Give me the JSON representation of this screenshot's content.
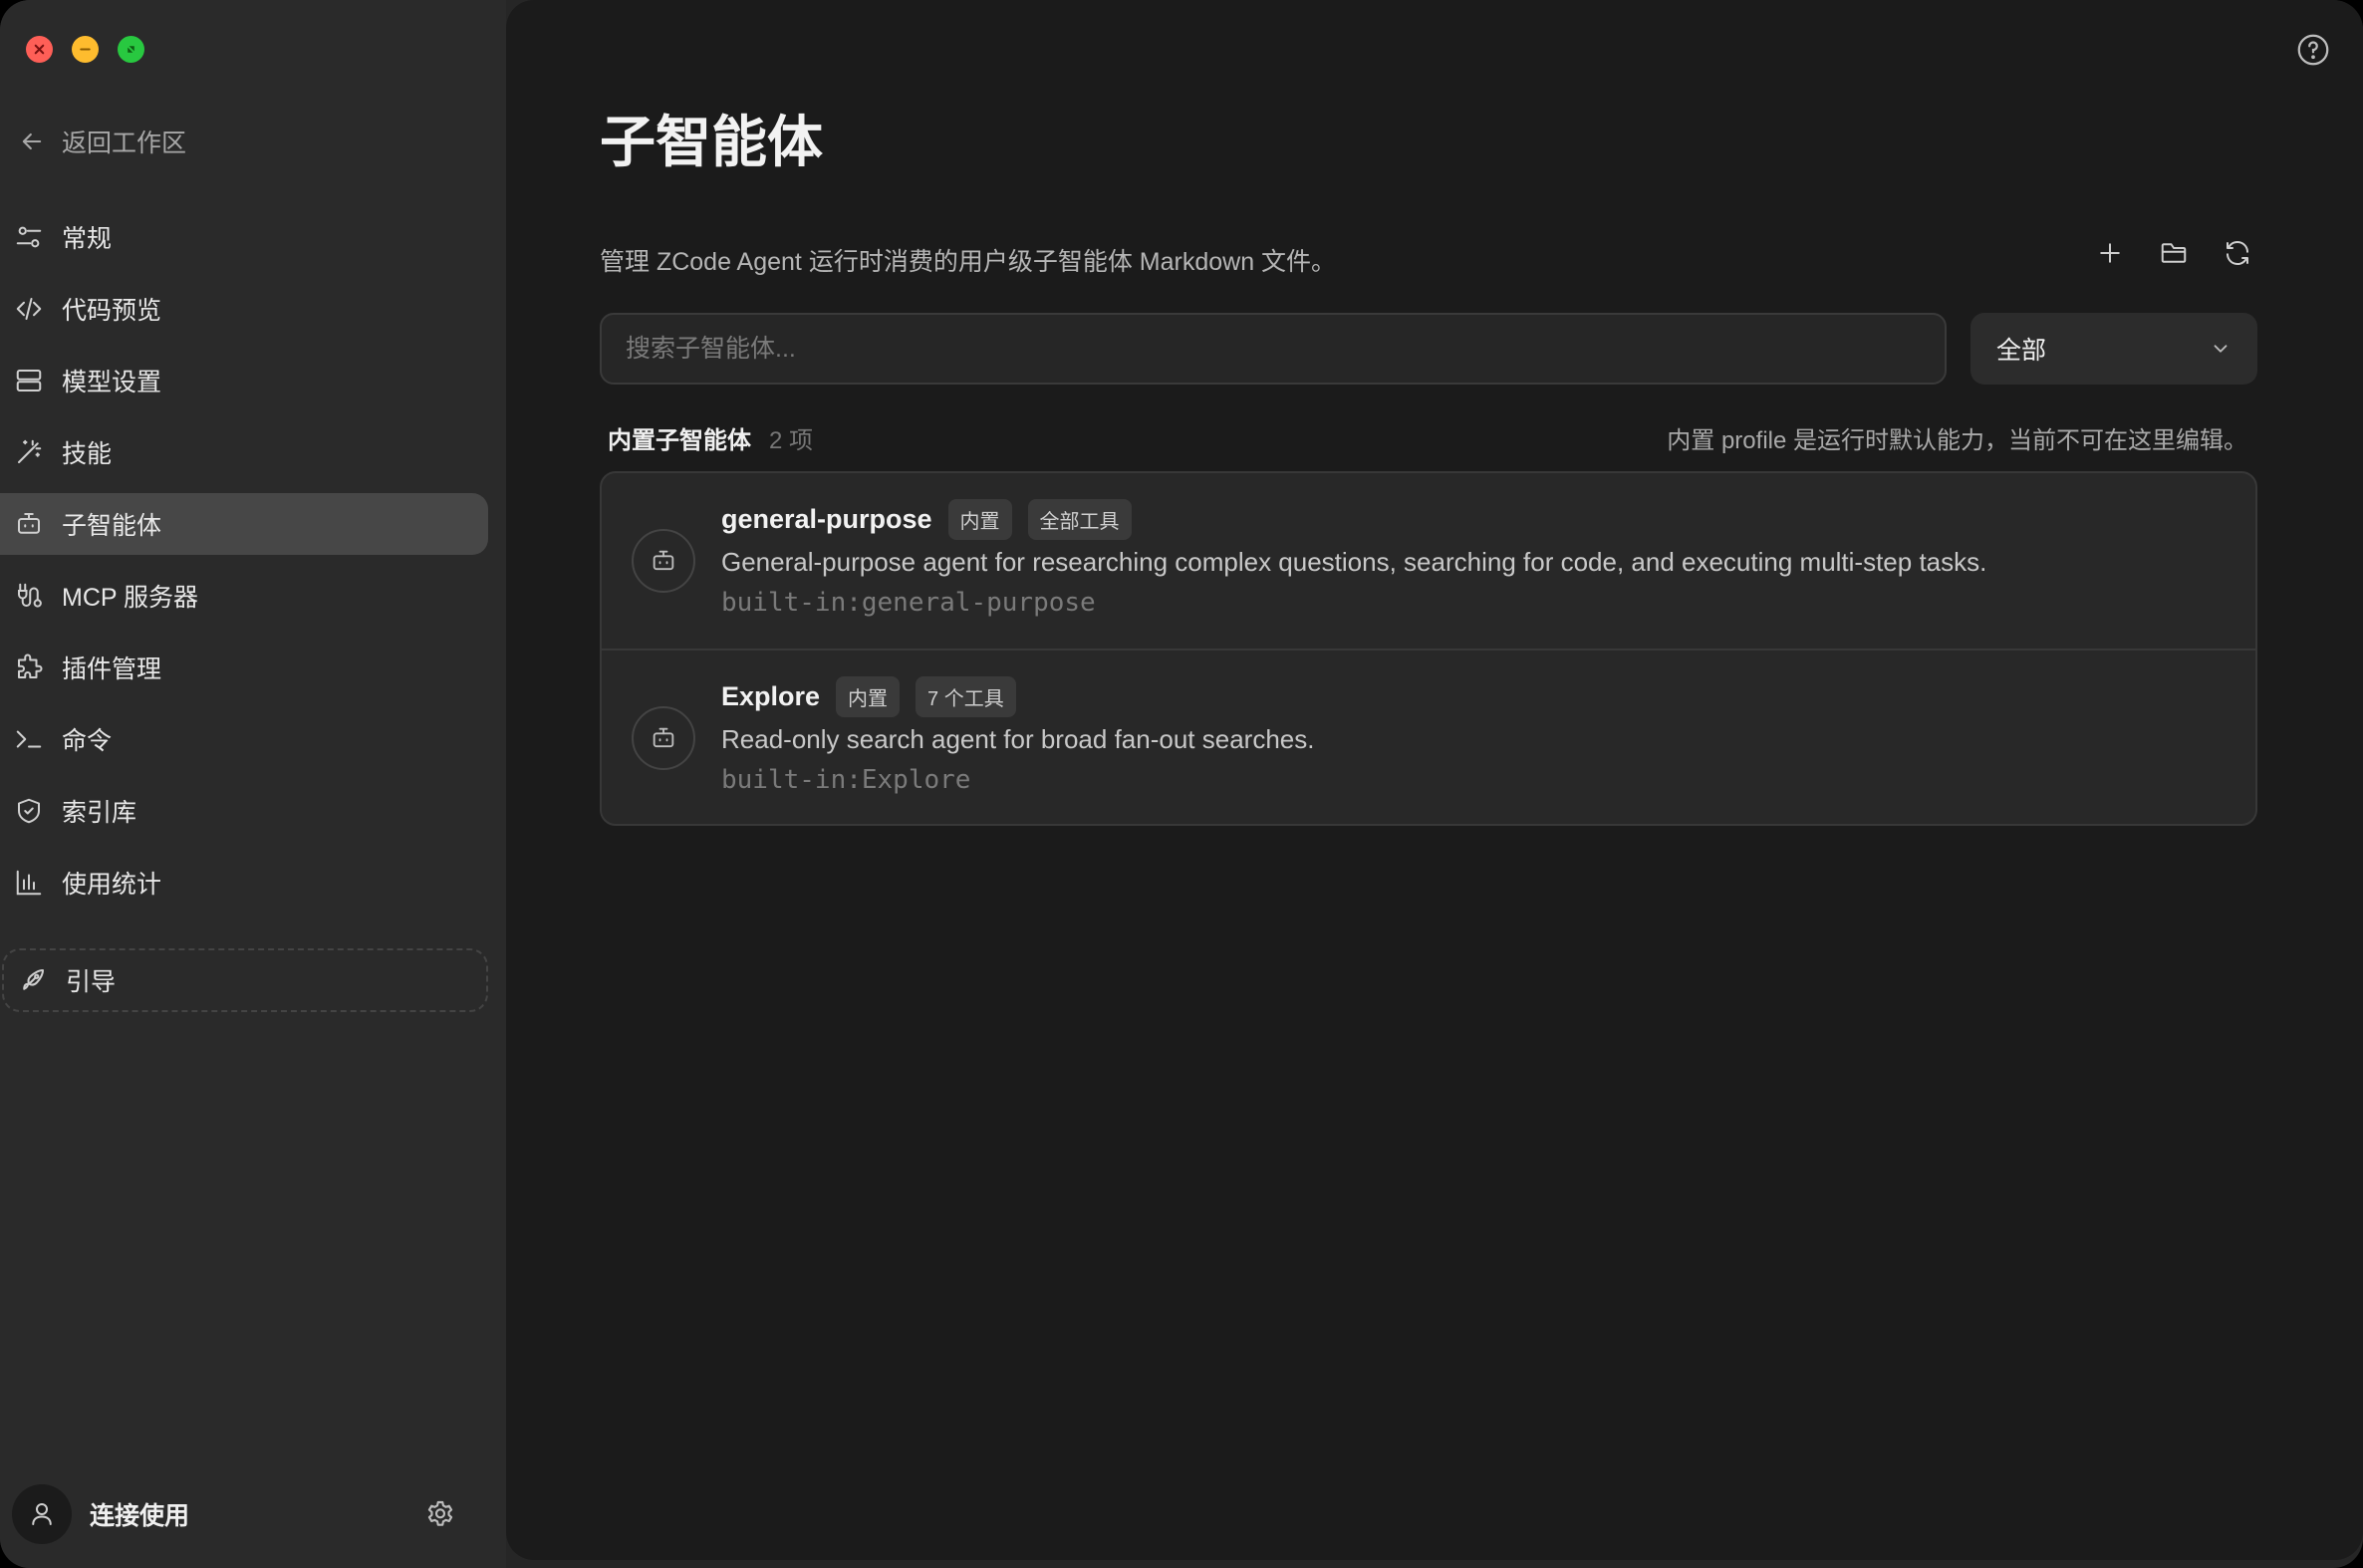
{
  "window": {
    "traffic_lights": [
      "close",
      "minimize",
      "maximize"
    ]
  },
  "sidebar": {
    "back_label": "返回工作区",
    "items": [
      {
        "label": "常规",
        "icon": "sliders-icon"
      },
      {
        "label": "代码预览",
        "icon": "code-icon"
      },
      {
        "label": "模型设置",
        "icon": "server-icon"
      },
      {
        "label": "技能",
        "icon": "magic-wand-icon"
      },
      {
        "label": "子智能体",
        "icon": "bot-icon",
        "active": true
      },
      {
        "label": "MCP 服务器",
        "icon": "plug-icon"
      },
      {
        "label": "插件管理",
        "icon": "puzzle-icon"
      },
      {
        "label": "命令",
        "icon": "terminal-icon"
      },
      {
        "label": "索引库",
        "icon": "shield-icon"
      },
      {
        "label": "使用统计",
        "icon": "bar-chart-icon"
      }
    ],
    "guide_label": "引导",
    "user_label": "连接使用"
  },
  "main": {
    "title": "子智能体",
    "description": "管理 ZCode Agent 运行时消费的用户级子智能体 Markdown 文件。",
    "search_placeholder": "搜索子智能体...",
    "filter_value": "全部",
    "section": {
      "title": "内置子智能体",
      "count": "2 项",
      "note": "内置 profile 是运行时默认能力，当前不可在这里编辑。"
    },
    "agents": [
      {
        "name": "general-purpose",
        "badges": [
          "内置",
          "全部工具"
        ],
        "description": "General-purpose agent for researching complex questions, searching for code, and executing multi-step tasks.",
        "id": "built-in:general-purpose"
      },
      {
        "name": "Explore",
        "badges": [
          "内置",
          "7 个工具"
        ],
        "description": "Read-only search agent for broad fan-out searches.",
        "id": "built-in:Explore"
      }
    ]
  },
  "colors": {
    "sidebar_bg": "#2a2a2a",
    "main_bg": "#1b1b1b",
    "active_item_bg": "#474747",
    "card_bg": "#282828"
  }
}
